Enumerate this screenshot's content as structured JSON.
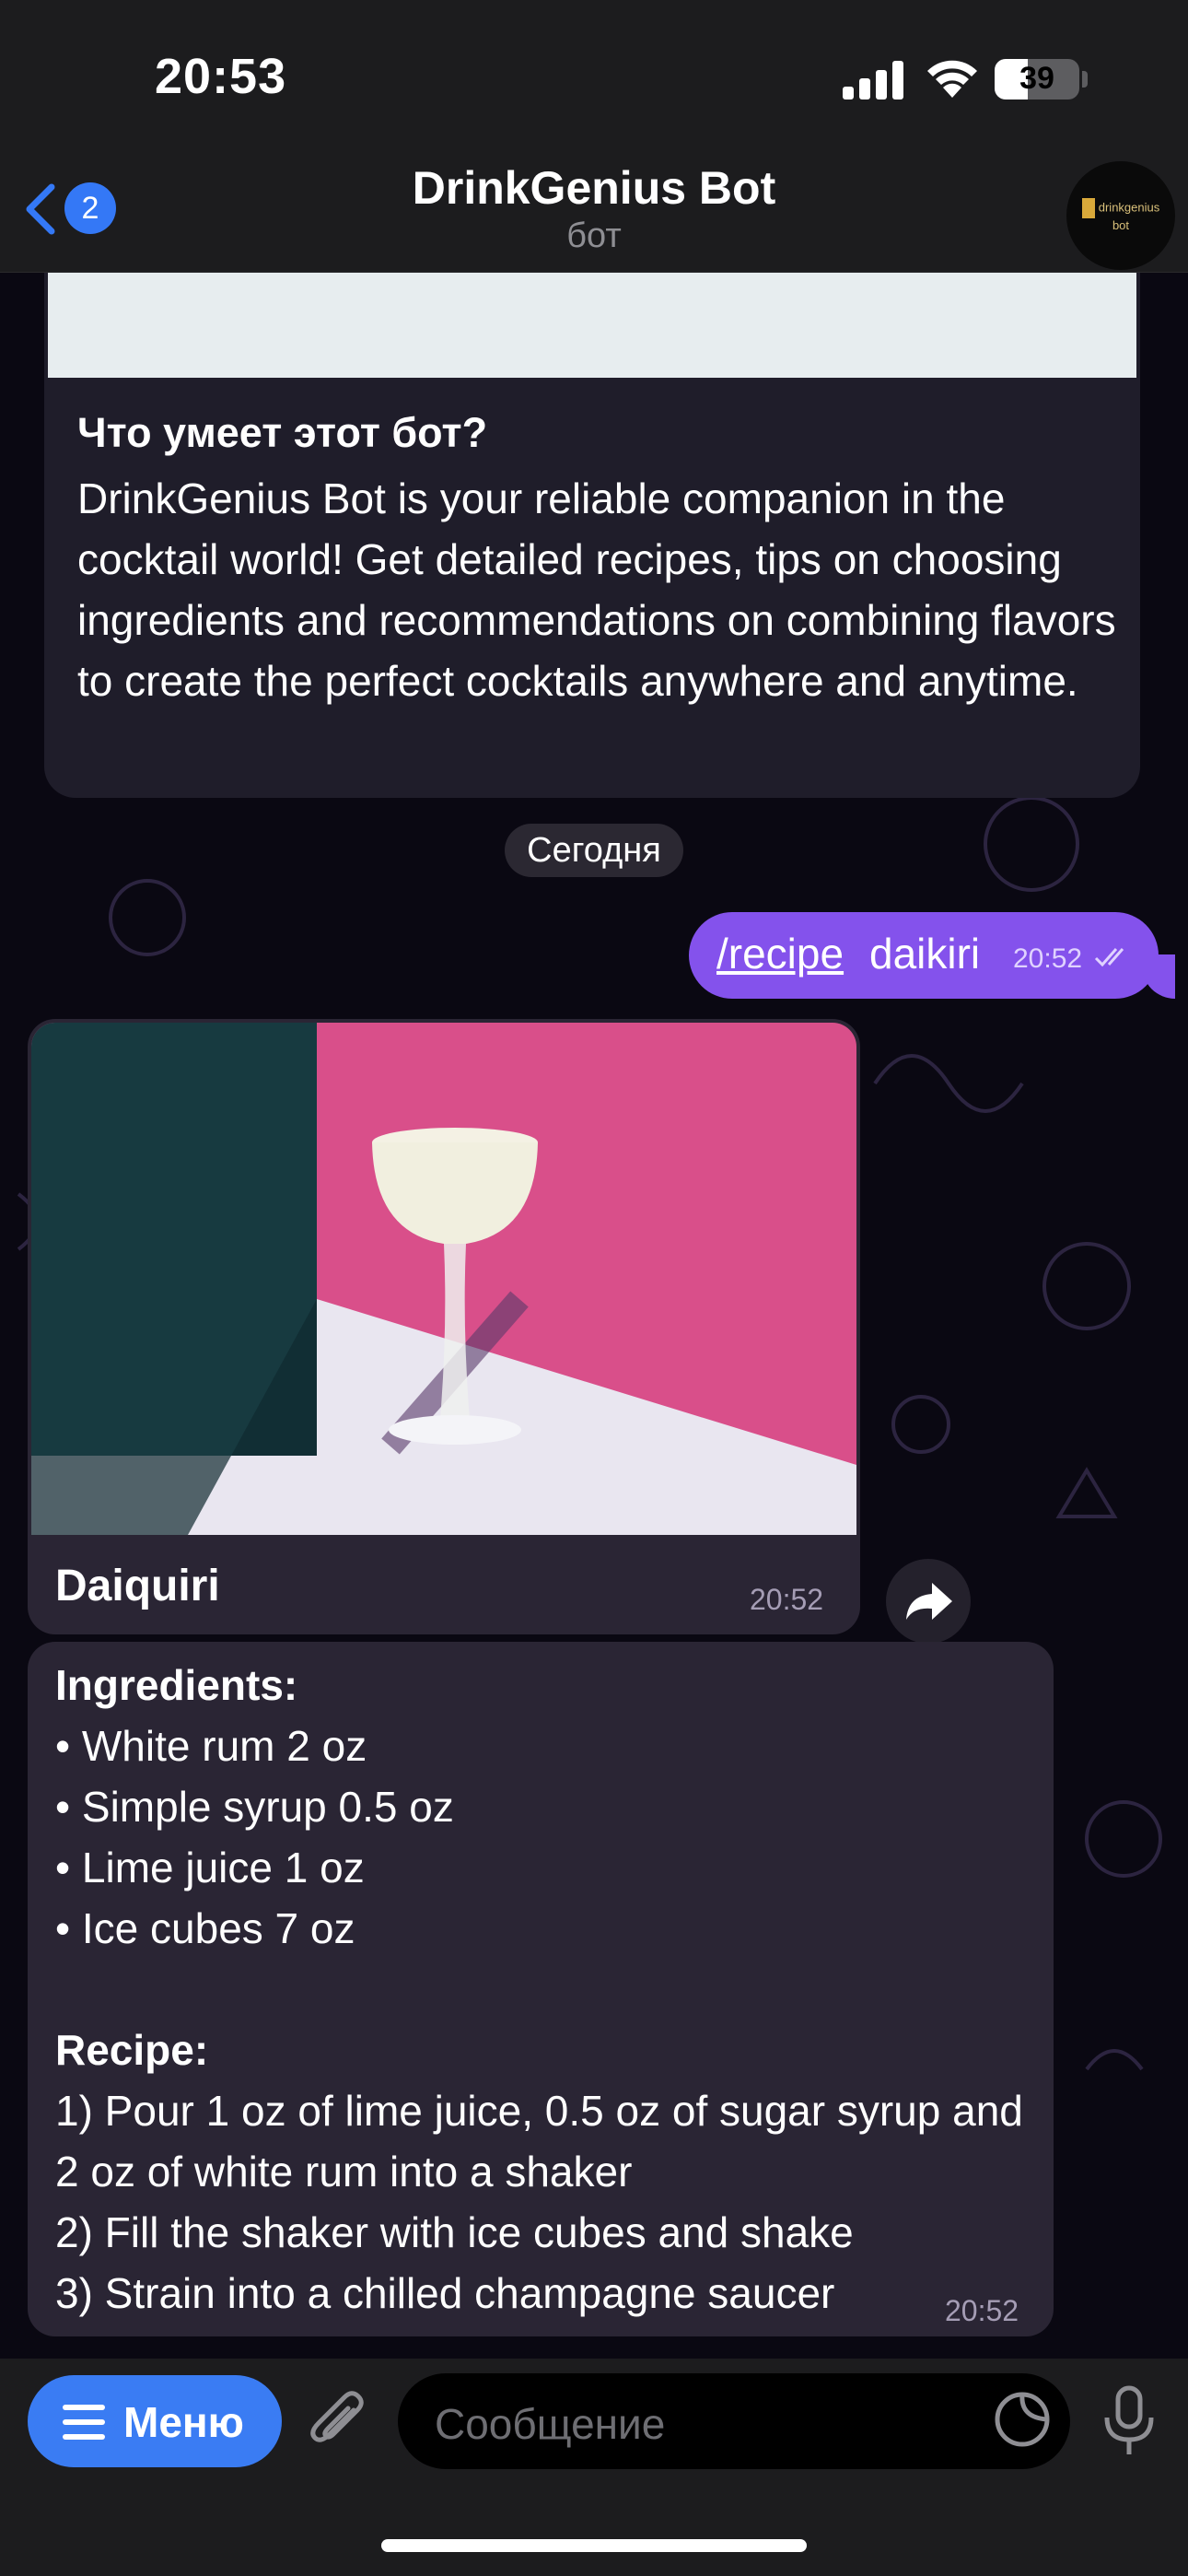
{
  "status_bar": {
    "time": "20:53",
    "battery": "39",
    "battery_level": 0.39
  },
  "header": {
    "back_count": "2",
    "title": "DrinkGenius Bot",
    "subtitle": "бот",
    "avatar_text": "drinkgenius bot"
  },
  "info": {
    "title": "Что умеет этот бот?",
    "text": "DrinkGenius Bot is your reliable companion in the cocktail world! Get detailed recipes, tips on choosing ingredients and recommendations on combining flavors to create the perfect cocktails anywhere and anytime."
  },
  "date_separator": "Сегодня",
  "outgoing": {
    "command": "/recipe",
    "argument": "daikiri",
    "time": "20:52"
  },
  "photo_message": {
    "name": "Daiquiri",
    "time": "20:52"
  },
  "recipe_message": {
    "ingredients_heading": "Ingredients:",
    "ingredients": [
      "• White rum  2 oz",
      "• Simple syrup  0.5 oz",
      "• Lime juice  1 oz",
      "• Ice cubes  7 oz"
    ],
    "recipe_heading": "Recipe:",
    "steps": [
      "1) Pour 1 oz of lime juice, 0.5 oz of sugar syrup and 2 oz of white rum into a shaker",
      "2) Fill the shaker with ice cubes and shake",
      "3) Strain into a chilled champagne saucer"
    ],
    "time": "20:52"
  },
  "input_bar": {
    "menu_label": "Меню",
    "placeholder": "Сообщение"
  },
  "colors": {
    "outgoing_bubble": "#8452ec",
    "incoming_bubble": "#2a2534",
    "accent": "#3478f6"
  }
}
